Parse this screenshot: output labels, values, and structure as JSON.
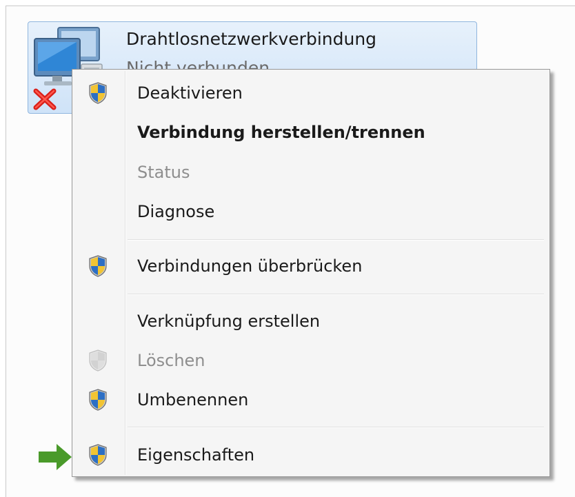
{
  "connection": {
    "name": "Drahtlosnetzwerkverbindung",
    "status": "Nicht verbunden",
    "icon": "network-computers-icon",
    "overlay_icon": "red-x-icon"
  },
  "context_menu": {
    "items": [
      {
        "label": "Deaktivieren",
        "icon": "uac-shield-icon",
        "style": "normal"
      },
      {
        "label": "Verbindung herstellen/trennen",
        "icon": "",
        "style": "bold"
      },
      {
        "label": "Status",
        "icon": "",
        "style": "disabled"
      },
      {
        "label": "Diagnose",
        "icon": "",
        "style": "normal"
      },
      {
        "label": "Verbindungen überbrücken",
        "icon": "uac-shield-icon",
        "style": "normal"
      },
      {
        "label": "Verknüpfung erstellen",
        "icon": "",
        "style": "normal"
      },
      {
        "label": "Löschen",
        "icon": "uac-shield-disabled-icon",
        "style": "disabled"
      },
      {
        "label": "Umbenennen",
        "icon": "uac-shield-icon",
        "style": "normal"
      },
      {
        "label": "Eigenschaften",
        "icon": "uac-shield-icon",
        "style": "normal"
      }
    ]
  },
  "annotation": {
    "icon": "green-arrow-icon",
    "color": "#4a9a2a"
  }
}
